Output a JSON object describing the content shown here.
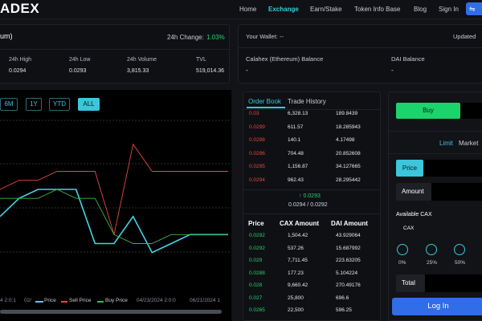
{
  "header": {
    "logo": "ADEX",
    "nav": [
      "Home",
      "Exchange",
      "Earn/Stake",
      "Token Info Base",
      "Blog",
      "Sign In"
    ],
    "active_nav": "Exchange",
    "wallet_icon": "wallet-icon"
  },
  "market": {
    "pair_name": "um)",
    "change_label": "24h Change:",
    "change_value": "1.03%",
    "stats": [
      {
        "label": "24h High",
        "value": "0.0294"
      },
      {
        "label": "24h Low",
        "value": "0.0293"
      },
      {
        "label": "24h Volume",
        "value": "3,815.33"
      },
      {
        "label": "TVL",
        "value": "519,014.36"
      }
    ]
  },
  "wallet": {
    "label": "Your Wallet: --",
    "updated": "Updated",
    "cax_label": "Calahex (Ethereum) Balance",
    "cax_value": "-",
    "dai_label": "DAI Balance",
    "dai_value": "-"
  },
  "chart": {
    "ranges": [
      "6M",
      "1Y",
      "YTD",
      "ALL"
    ],
    "active_range": "ALL",
    "x_ticks": [
      "4 2:0:1",
      "02/",
      "04/23/2024 2:0:0",
      "06/21/2024 1"
    ],
    "legend": [
      "Price",
      "Sell Price",
      "Buy Price"
    ],
    "legend_colors": [
      "#3fd8e6",
      "#e24a3a",
      "#3fb54a"
    ]
  },
  "chart_data": {
    "type": "line",
    "series": [
      {
        "name": "Price",
        "values": [
          0.0289,
          0.0291,
          0.0292,
          0.0292,
          0.0292,
          0.0286,
          0.0286,
          0.0289,
          0.0285,
          0.0286,
          0.0287,
          0.0287,
          0.0287
        ]
      },
      {
        "name": "Sell Price",
        "values": [
          0.0292,
          0.0293,
          0.0293,
          0.0294,
          0.0294,
          0.0294,
          0.0287,
          0.0297,
          0.0294,
          0.0294,
          0.0294,
          0.0294,
          0.0294
        ]
      },
      {
        "name": "Buy Price",
        "values": [
          0.0291,
          0.0291,
          0.0291,
          0.0292,
          0.0291,
          0.0291,
          0.0287,
          0.0286,
          0.0286,
          0.0287,
          0.0287,
          0.0287,
          0.0287
        ]
      }
    ],
    "xlabel": "",
    "ylabel": ""
  },
  "orderbook": {
    "tab_active": "Order Book",
    "tab_other": "Trade History",
    "sells": [
      {
        "price": "0.03",
        "amount": "6,328.13",
        "dai": "189.8439"
      },
      {
        "price": "0.0299",
        "amount": "611.57",
        "dai": "18.285943"
      },
      {
        "price": "0.0298",
        "amount": "140.1",
        "dai": "4.17498"
      },
      {
        "price": "0.0296",
        "amount": "704.48",
        "dai": "20.852608"
      },
      {
        "price": "0.0295",
        "amount": "1,156.87",
        "dai": "34.127665"
      },
      {
        "price": "0.0294",
        "amount": "962.43",
        "dai": "28.295442"
      }
    ],
    "mid_price": "↑ 0.0293",
    "spread": "0.0294 / 0.0292",
    "headers": [
      "Price",
      "CAX Amount",
      "DAI Amount"
    ],
    "buys": [
      {
        "price": "0.0292",
        "amount": "1,504.42",
        "dai": "43.929064"
      },
      {
        "price": "0.0292",
        "amount": "537.26",
        "dai": "15.687992"
      },
      {
        "price": "0.029",
        "amount": "7,711.45",
        "dai": "223.63205"
      },
      {
        "price": "0.0288",
        "amount": "177.23",
        "dai": "5.104224"
      },
      {
        "price": "0.028",
        "amount": "9,660.42",
        "dai": "270.49176"
      },
      {
        "price": "0.027",
        "amount": "25,800",
        "dai": "696.6"
      },
      {
        "price": "0.0265",
        "amount": "22,500",
        "dai": "596.25"
      }
    ]
  },
  "trade": {
    "buy_label": "Buy",
    "limit_label": "Limit",
    "market_label": "Market",
    "price_label": "Price",
    "amount_label": "Amount",
    "available_label": "Available CAX",
    "cax_label": "CAX",
    "percents": [
      "0%",
      "25%",
      "50%"
    ],
    "total_label": "Total",
    "login_label": "Log In"
  }
}
